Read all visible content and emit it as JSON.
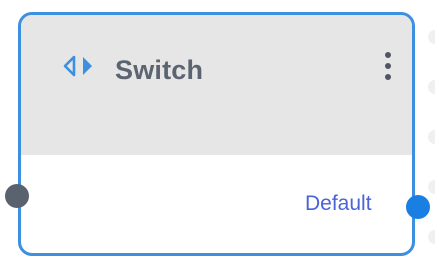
{
  "node": {
    "title": "Switch",
    "icon": "switch-icon",
    "menu_icon": "kebab-menu-icon",
    "output_label": "Default"
  },
  "colors": {
    "accent": "#3d8fe0",
    "header_bg": "#e6e6e6",
    "title_text": "#5b6470",
    "output_label_text": "#4b63d8",
    "input_port": "#5a6270",
    "output_port": "#1a7fe3"
  }
}
